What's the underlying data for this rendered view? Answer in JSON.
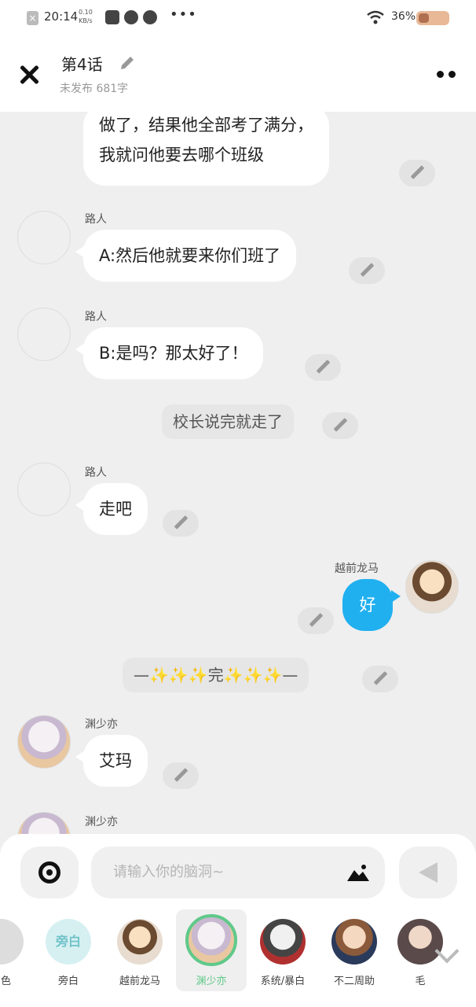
{
  "status_bar": {
    "time": "20:14",
    "net_speed_value": "0.10",
    "net_speed_unit": "KB/s",
    "dots": "•••",
    "battery_text": "36%",
    "battery_level": 0.36
  },
  "header": {
    "title": "第4话",
    "subtitle": "未发布 681字"
  },
  "messages": [
    {
      "type": "left",
      "speaker": "",
      "lines": [
        "做了，结果他全部考了满分，",
        "我就问他要去哪个班级"
      ]
    },
    {
      "type": "left",
      "speaker": "路人",
      "text": "A:然后他就要来你们班了"
    },
    {
      "type": "left",
      "speaker": "路人",
      "text": "B:是吗？那太好了！"
    },
    {
      "type": "narration",
      "text": "校长说完就走了"
    },
    {
      "type": "left",
      "speaker": "路人",
      "text": "走吧"
    },
    {
      "type": "right",
      "speaker": "越前龙马",
      "text": "好"
    },
    {
      "type": "narration",
      "text": "—✨✨✨完✨✨✨—"
    },
    {
      "type": "left",
      "speaker": "渊少亦",
      "text": "艾玛"
    },
    {
      "type": "left",
      "speaker": "渊少亦",
      "text": ""
    }
  ],
  "input": {
    "placeholder": "请输入你的脑洞~"
  },
  "characters": [
    {
      "name": "角色"
    },
    {
      "name": "旁白",
      "avatar_text": "旁白"
    },
    {
      "name": "越前龙马"
    },
    {
      "name": "渊少亦",
      "selected": true
    },
    {
      "name": "系统/暴白"
    },
    {
      "name": "不二周助"
    },
    {
      "name": "毛"
    }
  ]
}
